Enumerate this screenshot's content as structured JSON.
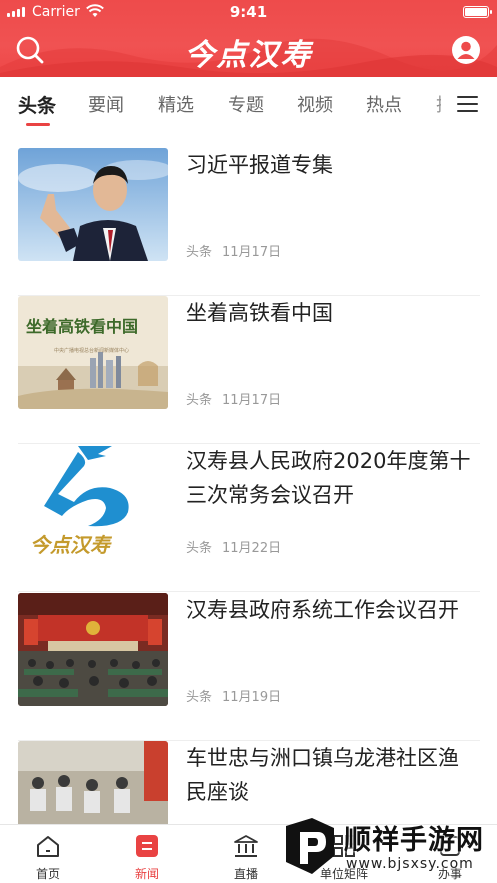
{
  "status_bar": {
    "carrier": "Carrier",
    "time": "9:41"
  },
  "header": {
    "app_logo": "今点汉寿"
  },
  "tabs": [
    {
      "label": "头条",
      "active": true
    },
    {
      "label": "要闻"
    },
    {
      "label": "精选"
    },
    {
      "label": "专题"
    },
    {
      "label": "视频"
    },
    {
      "label": "热点"
    },
    {
      "label": "技"
    }
  ],
  "articles": [
    {
      "title": "习近平报道专集",
      "category": "头条",
      "date": "11月17日",
      "thumb": "portrait-photo"
    },
    {
      "title": "坐着高铁看中国",
      "category": "头条",
      "date": "11月17日",
      "thumb": "high-speed-rail-poster",
      "thumb_text": {
        "headline": "坐着高铁看中国",
        "subtitle": "中央广播电视总台新闻新媒体中心"
      }
    },
    {
      "title": "汉寿县人民政府2020年度第十三次常务会议召开",
      "category": "头条",
      "date": "11月22日",
      "thumb": "hanshou-logo",
      "thumb_text": {
        "logo_text": "今点汉寿"
      }
    },
    {
      "title": "汉寿县政府系统工作会议召开",
      "category": "头条",
      "date": "11月19日",
      "thumb": "meeting-hall-photo"
    },
    {
      "title": "车世忠与洲口镇乌龙港社区渔民座谈",
      "category": "",
      "date": "",
      "thumb": "outdoor-meeting-photo"
    }
  ],
  "bottom_nav": [
    {
      "label": "首页",
      "icon": "home-icon"
    },
    {
      "label": "新闻",
      "icon": "news-icon",
      "active": true
    },
    {
      "label": "直播",
      "icon": "live-icon"
    },
    {
      "label": "单位矩阵",
      "icon": "matrix-icon"
    },
    {
      "label": "办事",
      "icon": "service-icon"
    }
  ],
  "watermark": {
    "name": "顺祥手游网",
    "url": "www.bjsxsy.com"
  },
  "colors": {
    "brand": "#ee4b4b",
    "text": "#222222",
    "meta": "#999999"
  }
}
